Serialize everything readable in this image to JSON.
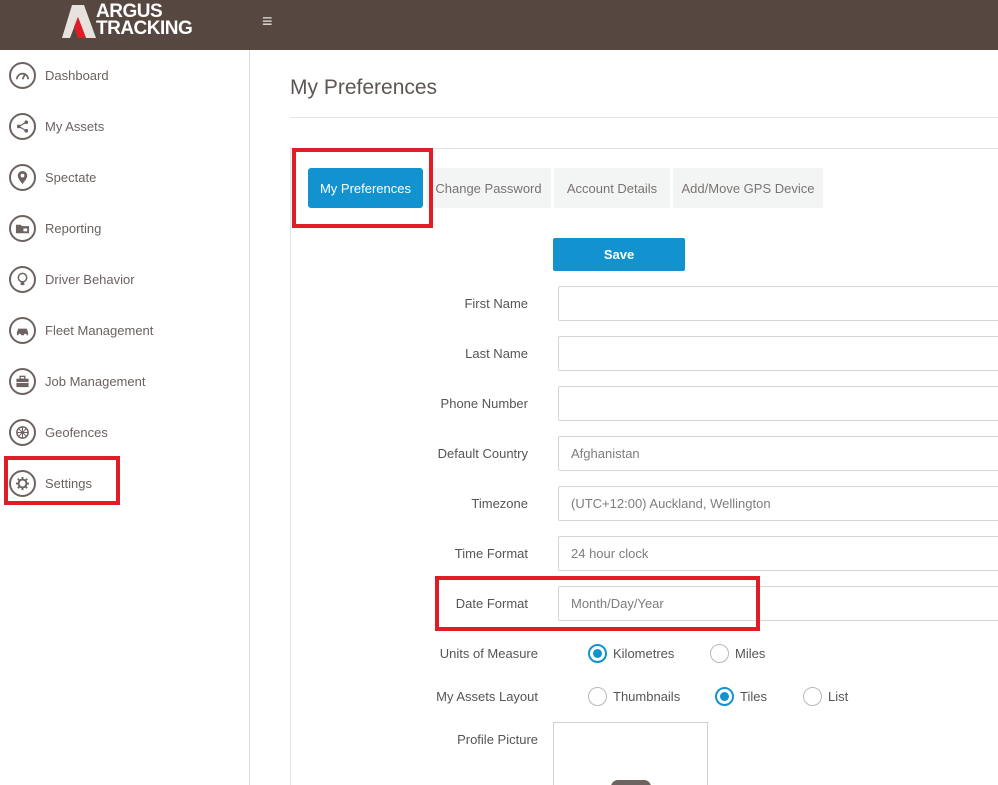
{
  "brand": {
    "line1": "ARGUS",
    "line2": "TRACKING"
  },
  "header": {
    "menu_icon": "≡"
  },
  "sidebar": {
    "items": [
      {
        "label": "Dashboard",
        "icon": "gauge-icon"
      },
      {
        "label": "My Assets",
        "icon": "network-icon"
      },
      {
        "label": "Spectate",
        "icon": "map-pin-icon"
      },
      {
        "label": "Reporting",
        "icon": "folder-report-icon"
      },
      {
        "label": "Driver Behavior",
        "icon": "lightbulb-icon"
      },
      {
        "label": "Fleet Management",
        "icon": "car-icon"
      },
      {
        "label": "Job Management",
        "icon": "briefcase-icon"
      },
      {
        "label": "Geofences",
        "icon": "wheel-icon"
      },
      {
        "label": "Settings",
        "icon": "gear-icon"
      }
    ]
  },
  "page": {
    "title": "My Preferences"
  },
  "tabs": [
    {
      "label": "My Preferences",
      "active": true
    },
    {
      "label": "Change Password",
      "active": false
    },
    {
      "label": "Account Details",
      "active": false
    },
    {
      "label": "Add/Move GPS Device",
      "active": false
    }
  ],
  "form": {
    "save_label": "Save",
    "fields": [
      {
        "label": "First Name",
        "value": ""
      },
      {
        "label": "Last Name",
        "value": ""
      },
      {
        "label": "Phone Number",
        "value": ""
      },
      {
        "label": "Default Country",
        "value": "Afghanistan"
      },
      {
        "label": "Timezone",
        "value": "(UTC+12:00) Auckland, Wellington"
      },
      {
        "label": "Time Format",
        "value": "24 hour clock"
      },
      {
        "label": "Date Format",
        "value": "Month/Day/Year"
      }
    ],
    "units": {
      "label": "Units of Measure",
      "options": [
        "Kilometres",
        "Miles"
      ],
      "selected": "Kilometres"
    },
    "layout": {
      "label": "My Assets Layout",
      "options": [
        "Thumbnails",
        "Tiles",
        "List"
      ],
      "selected": "Tiles"
    },
    "profile_picture_label": "Profile Picture"
  },
  "colors": {
    "header_bg": "#564841",
    "accent": "#1293cf",
    "highlight": "#e01d26"
  }
}
